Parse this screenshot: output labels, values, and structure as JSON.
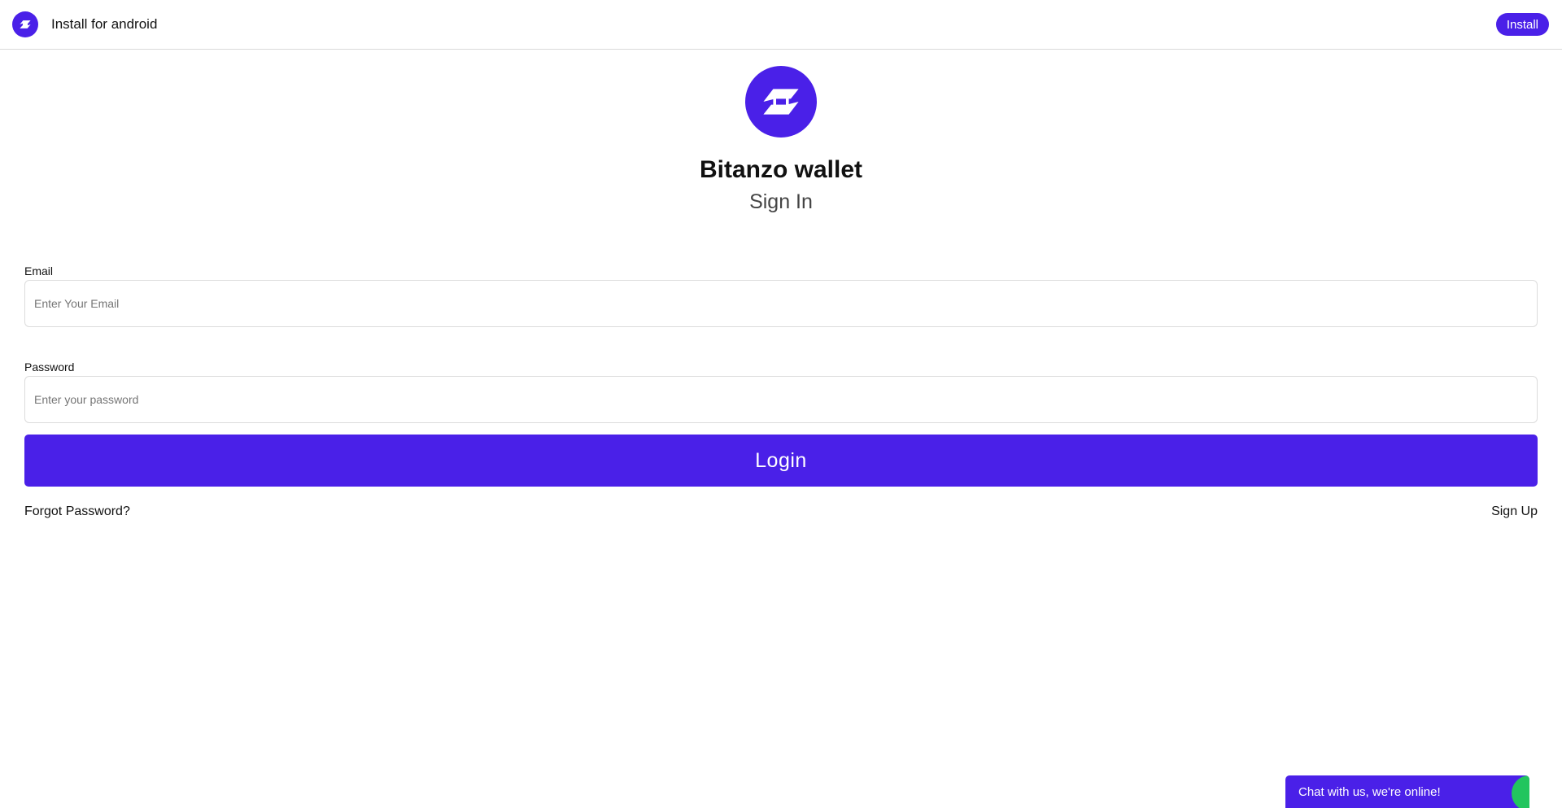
{
  "topbar": {
    "app_label": "Install for android",
    "install_label": "Install",
    "icon": "app-logo-icon"
  },
  "brand": {
    "icon": "bitanzo-logo-icon",
    "title": "Bitanzo wallet",
    "subtitle": "Sign In"
  },
  "form": {
    "email": {
      "label": "Email",
      "placeholder": "Enter Your Email",
      "value": ""
    },
    "password": {
      "label": "Password",
      "placeholder": "Enter your password",
      "value": ""
    },
    "login_label": "Login",
    "forgot_label": "Forgot Password?",
    "signup_label": "Sign Up"
  },
  "chat": {
    "label": "Chat with us, we're online!",
    "status_color": "#22c55e"
  },
  "colors": {
    "accent": "#4a20e8"
  }
}
